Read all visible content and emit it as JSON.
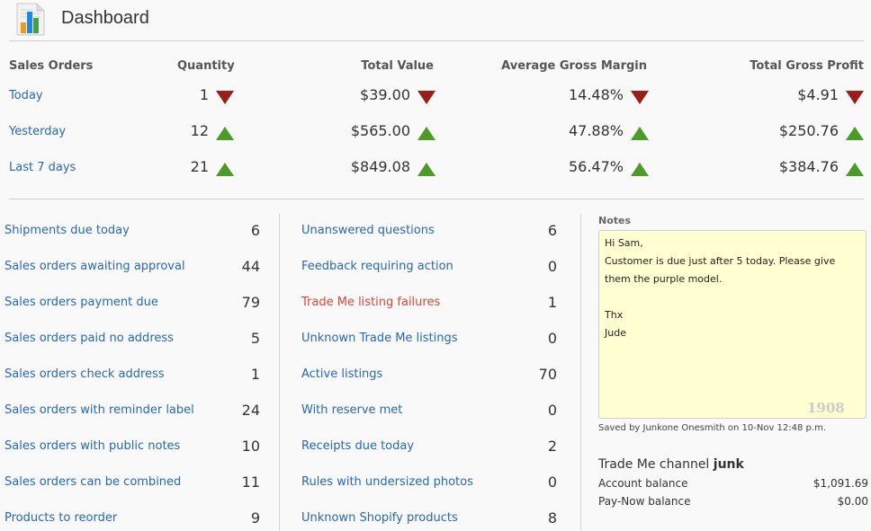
{
  "header": {
    "title": "Dashboard",
    "icon": "bar-chart-document-icon"
  },
  "summary": {
    "headers": [
      "Sales Orders",
      "Quantity",
      "Total Value",
      "Average Gross Margin",
      "Total Gross Profit"
    ],
    "rows": [
      {
        "label": "Today",
        "quantity": "1",
        "quantity_trend": "down",
        "total_value": "$39.00",
        "total_value_trend": "down",
        "avg_margin": "14.48%",
        "avg_margin_trend": "down",
        "gross_profit": "$4.91",
        "gross_profit_trend": "down"
      },
      {
        "label": "Yesterday",
        "quantity": "12",
        "quantity_trend": "up",
        "total_value": "$565.00",
        "total_value_trend": "up",
        "avg_margin": "47.88%",
        "avg_margin_trend": "up",
        "gross_profit": "$250.76",
        "gross_profit_trend": "up"
      },
      {
        "label": "Last 7 days",
        "quantity": "21",
        "quantity_trend": "up",
        "total_value": "$849.08",
        "total_value_trend": "up",
        "avg_margin": "56.47%",
        "avg_margin_trend": "up",
        "gross_profit": "$384.76",
        "gross_profit_trend": "up"
      }
    ],
    "colors": {
      "up": "#4c9a27",
      "down": "#9a1f1a"
    }
  },
  "left_list": [
    {
      "label": "Shipments due today",
      "count": "6"
    },
    {
      "label": "Sales orders awaiting approval",
      "count": "44"
    },
    {
      "label": "Sales orders payment due",
      "count": "79"
    },
    {
      "label": "Sales orders paid no address",
      "count": "5"
    },
    {
      "label": "Sales orders check address",
      "count": "1"
    },
    {
      "label": "Sales orders with reminder label",
      "count": "24"
    },
    {
      "label": "Sales orders with public notes",
      "count": "10"
    },
    {
      "label": "Sales orders can be combined",
      "count": "11"
    },
    {
      "label": "Products to reorder",
      "count": "9"
    }
  ],
  "middle_list": [
    {
      "label": "Unanswered questions",
      "count": "6"
    },
    {
      "label": "Feedback requiring action",
      "count": "0"
    },
    {
      "label": "Trade Me listing failures",
      "count": "1",
      "alert": true
    },
    {
      "label": "Unknown Trade Me listings",
      "count": "0"
    },
    {
      "label": "Active listings",
      "count": "70"
    },
    {
      "label": "With reserve met",
      "count": "0"
    },
    {
      "label": "Receipts due today",
      "count": "2"
    },
    {
      "label": "Rules with undersized photos",
      "count": "0"
    },
    {
      "label": "Unknown Shopify products",
      "count": "8"
    }
  ],
  "notes": {
    "label": "Notes",
    "text": "Hi Sam,\nCustomer is due just after 5 today. Please give them the purple model.\n\nThx\nJude",
    "char_count": "1908",
    "saved_by": "Saved by Junkone Onesmith on 10-Nov 12:48 p.m."
  },
  "channel": {
    "prefix": "Trade Me channel",
    "name": "junk",
    "account_balance_label": "Account balance",
    "account_balance": "$1,091.69",
    "paynow_balance_label": "Pay-Now balance",
    "paynow_balance": "$0.00"
  },
  "colors": {
    "link": "#2767b8",
    "alert_link": "#e0443a",
    "notes_bg": "#ffffd1"
  }
}
